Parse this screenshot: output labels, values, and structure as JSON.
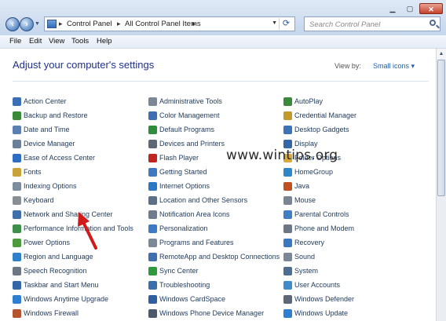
{
  "window": {
    "breadcrumb": [
      "Control Panel",
      "All Control Panel Items"
    ],
    "search_placeholder": "Search Control Panel"
  },
  "menu": [
    "File",
    "Edit",
    "View",
    "Tools",
    "Help"
  ],
  "header": {
    "title": "Adjust your computer's settings",
    "view_by_label": "View by:",
    "view_by_value": "Small icons"
  },
  "watermark": "www.wintips.org",
  "columns": [
    {
      "items": [
        {
          "label": "Action Center",
          "icon": "flag-icon",
          "color": "#3a6fb4"
        },
        {
          "label": "Backup and Restore",
          "icon": "backup-icon",
          "color": "#3b8a3a"
        },
        {
          "label": "Date and Time",
          "icon": "clock-icon",
          "color": "#5a7fb0"
        },
        {
          "label": "Device Manager",
          "icon": "device-manager-icon",
          "color": "#6c7f99"
        },
        {
          "label": "Ease of Access Center",
          "icon": "ease-of-access-icon",
          "color": "#2e6ec2"
        },
        {
          "label": "Fonts",
          "icon": "fonts-icon",
          "color": "#c9a23a"
        },
        {
          "label": "Indexing Options",
          "icon": "indexing-icon",
          "color": "#7d8d9e"
        },
        {
          "label": "Keyboard",
          "icon": "keyboard-icon",
          "color": "#8a8f96"
        },
        {
          "label": "Network and Sharing Center",
          "icon": "network-icon",
          "color": "#3f6fa8"
        },
        {
          "label": "Performance Information and Tools",
          "icon": "performance-icon",
          "color": "#3d8f4b"
        },
        {
          "label": "Power Options",
          "icon": "power-icon",
          "color": "#4f9a3d"
        },
        {
          "label": "Region and Language",
          "icon": "globe-icon",
          "color": "#2f7fc9"
        },
        {
          "label": "Speech Recognition",
          "icon": "microphone-icon",
          "color": "#6d7783"
        },
        {
          "label": "Taskbar and Start Menu",
          "icon": "taskbar-icon",
          "color": "#3566a7"
        },
        {
          "label": "Windows Anytime Upgrade",
          "icon": "windows-upgrade-icon",
          "color": "#2f7fd0"
        },
        {
          "label": "Windows Firewall",
          "icon": "firewall-icon",
          "color": "#b5542f"
        }
      ]
    },
    {
      "items": [
        {
          "label": "Administrative Tools",
          "icon": "admin-tools-icon",
          "color": "#7b8796"
        },
        {
          "label": "Color Management",
          "icon": "color-management-icon",
          "color": "#3e6fb2"
        },
        {
          "label": "Default Programs",
          "icon": "default-programs-icon",
          "color": "#2f8d3b"
        },
        {
          "label": "Devices and Printers",
          "icon": "printer-icon",
          "color": "#5d6877"
        },
        {
          "label": "Flash Player",
          "icon": "flash-icon",
          "color": "#c0261f"
        },
        {
          "label": "Getting Started",
          "icon": "getting-started-icon",
          "color": "#3f79c2"
        },
        {
          "label": "Internet Options",
          "icon": "internet-icon",
          "color": "#2d77c7"
        },
        {
          "label": "Location and Other Sensors",
          "icon": "sensors-icon",
          "color": "#5c6f88"
        },
        {
          "label": "Notification Area Icons",
          "icon": "notification-icon",
          "color": "#6f7c8e"
        },
        {
          "label": "Personalization",
          "icon": "personalization-icon",
          "color": "#3d7bc4"
        },
        {
          "label": "Programs and Features",
          "icon": "programs-icon",
          "color": "#7b8999"
        },
        {
          "label": "RemoteApp and Desktop Connections",
          "icon": "remoteapp-icon",
          "color": "#3f6fb0"
        },
        {
          "label": "Sync Center",
          "icon": "sync-icon",
          "color": "#2f9a3c"
        },
        {
          "label": "Troubleshooting",
          "icon": "troubleshooting-icon",
          "color": "#3a6fae"
        },
        {
          "label": "Windows CardSpace",
          "icon": "cardspace-icon",
          "color": "#2f5f9e"
        },
        {
          "label": "Windows Phone Device Manager",
          "icon": "phone-icon",
          "color": "#4b5a6c"
        }
      ]
    },
    {
      "items": [
        {
          "label": "AutoPlay",
          "icon": "autoplay-icon",
          "color": "#3a8a3c"
        },
        {
          "label": "Credential Manager",
          "icon": "credential-icon",
          "color": "#c49a2c"
        },
        {
          "label": "Desktop Gadgets",
          "icon": "gadgets-icon",
          "color": "#3d74b8"
        },
        {
          "label": "Display",
          "icon": "display-icon",
          "color": "#3567a8"
        },
        {
          "label": "Folder Options",
          "icon": "folder-icon",
          "color": "#d8a93a"
        },
        {
          "label": "HomeGroup",
          "icon": "homegroup-icon",
          "color": "#2f87c9"
        },
        {
          "label": "Java",
          "icon": "java-icon",
          "color": "#c0501f"
        },
        {
          "label": "Mouse",
          "icon": "mouse-icon",
          "color": "#7a8594"
        },
        {
          "label": "Parental Controls",
          "icon": "parental-icon",
          "color": "#3f7fc2"
        },
        {
          "label": "Phone and Modem",
          "icon": "modem-icon",
          "color": "#6b7686"
        },
        {
          "label": "Recovery",
          "icon": "recovery-icon",
          "color": "#3c78bf"
        },
        {
          "label": "Sound",
          "icon": "sound-icon",
          "color": "#7b8797"
        },
        {
          "label": "System",
          "icon": "system-icon",
          "color": "#4d6d93"
        },
        {
          "label": "User Accounts",
          "icon": "user-accounts-icon",
          "color": "#3f8ac9"
        },
        {
          "label": "Windows Defender",
          "icon": "defender-icon",
          "color": "#5c6777"
        },
        {
          "label": "Windows Update",
          "icon": "windows-update-icon",
          "color": "#2f7fd0"
        }
      ]
    }
  ]
}
